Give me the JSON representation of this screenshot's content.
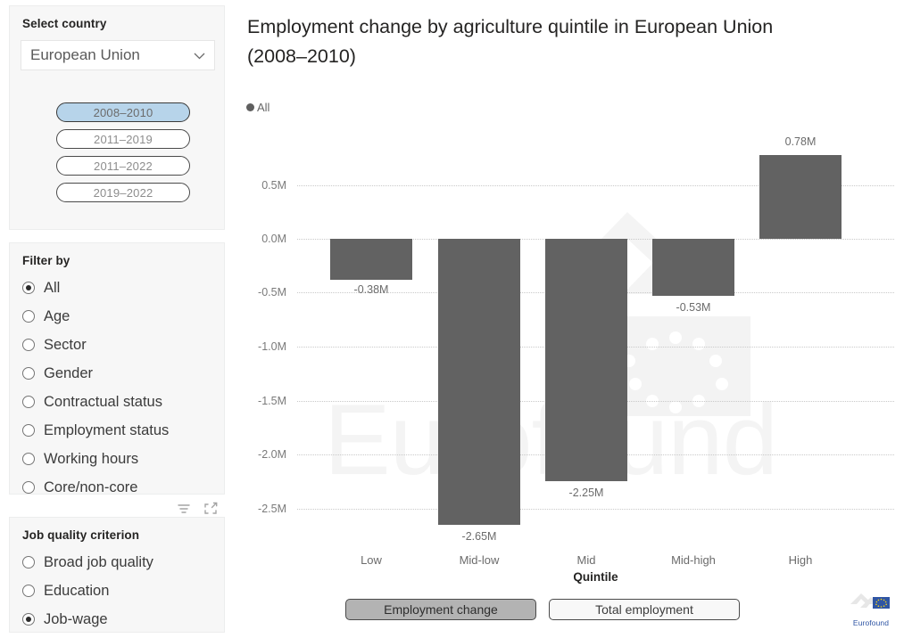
{
  "sidebar": {
    "country_panel": {
      "title": "Select country",
      "dropdown": {
        "name": "country-select",
        "value": "European Union",
        "icon": "chevron-down-icon"
      },
      "periods": [
        {
          "label": "2008–2010",
          "selected": true
        },
        {
          "label": "2011–2019",
          "selected": false
        },
        {
          "label": "2011–2022",
          "selected": false
        },
        {
          "label": "2019–2022",
          "selected": false
        }
      ]
    },
    "filter_panel": {
      "title": "Filter by",
      "options": [
        {
          "label": "All",
          "selected": true
        },
        {
          "label": "Age",
          "selected": false
        },
        {
          "label": "Sector",
          "selected": false
        },
        {
          "label": "Gender",
          "selected": false
        },
        {
          "label": "Contractual status",
          "selected": false
        },
        {
          "label": "Employment status",
          "selected": false
        },
        {
          "label": "Working hours",
          "selected": false
        },
        {
          "label": "Core/non-core",
          "selected": false
        }
      ],
      "icons": [
        "filter-icon",
        "focus-mode-icon"
      ]
    },
    "job_quality_panel": {
      "title": "Job quality criterion",
      "options": [
        {
          "label": "Broad job quality",
          "selected": false
        },
        {
          "label": "Education",
          "selected": false
        },
        {
          "label": "Job-wage",
          "selected": true
        }
      ]
    }
  },
  "chart": {
    "title": "Employment change by agriculture quintile in European Union (2008–2010)",
    "legend": {
      "label": "All",
      "color": "#5f5f5f"
    }
  },
  "bottom_toggles": [
    {
      "label": "Employment change",
      "active": true
    },
    {
      "label": "Total employment",
      "active": false
    }
  ],
  "branding": {
    "logo_text": "Eurofound",
    "watermark_text": "Eurofound"
  },
  "colors": {
    "bar": "#626262",
    "selected_pill": "#b7d4ea",
    "active_toggle": "#b3b3b3",
    "panel_bg": "#f7f7f7"
  },
  "chart_data": {
    "type": "bar",
    "title": "Employment change by agriculture quintile in European Union (2008–2010)",
    "xlabel": "Quintile",
    "ylabel": "",
    "categories": [
      "Low",
      "Mid-low",
      "Mid",
      "Mid-high",
      "High"
    ],
    "values": [
      -0.38,
      -2.65,
      -2.25,
      -0.53,
      0.78
    ],
    "value_labels": [
      "-0.38M",
      "-2.65M",
      "-2.25M",
      "-0.53M",
      "0.78M"
    ],
    "unit": "M",
    "ylim": [
      -2.5,
      0.5
    ],
    "yticks": [
      0.5,
      0.0,
      -0.5,
      -1.0,
      -1.5,
      -2.0,
      -2.5
    ],
    "ytick_labels": [
      "0.5M",
      "0.0M",
      "-0.5M",
      "-1.0M",
      "-1.5M",
      "-2.0M",
      "-2.5M"
    ],
    "grid": true,
    "legend": [
      "All"
    ],
    "legend_position": "top-left",
    "series": [
      {
        "name": "All",
        "color": "#626262",
        "values": [
          -0.38,
          -2.65,
          -2.25,
          -0.53,
          0.78
        ]
      }
    ]
  }
}
